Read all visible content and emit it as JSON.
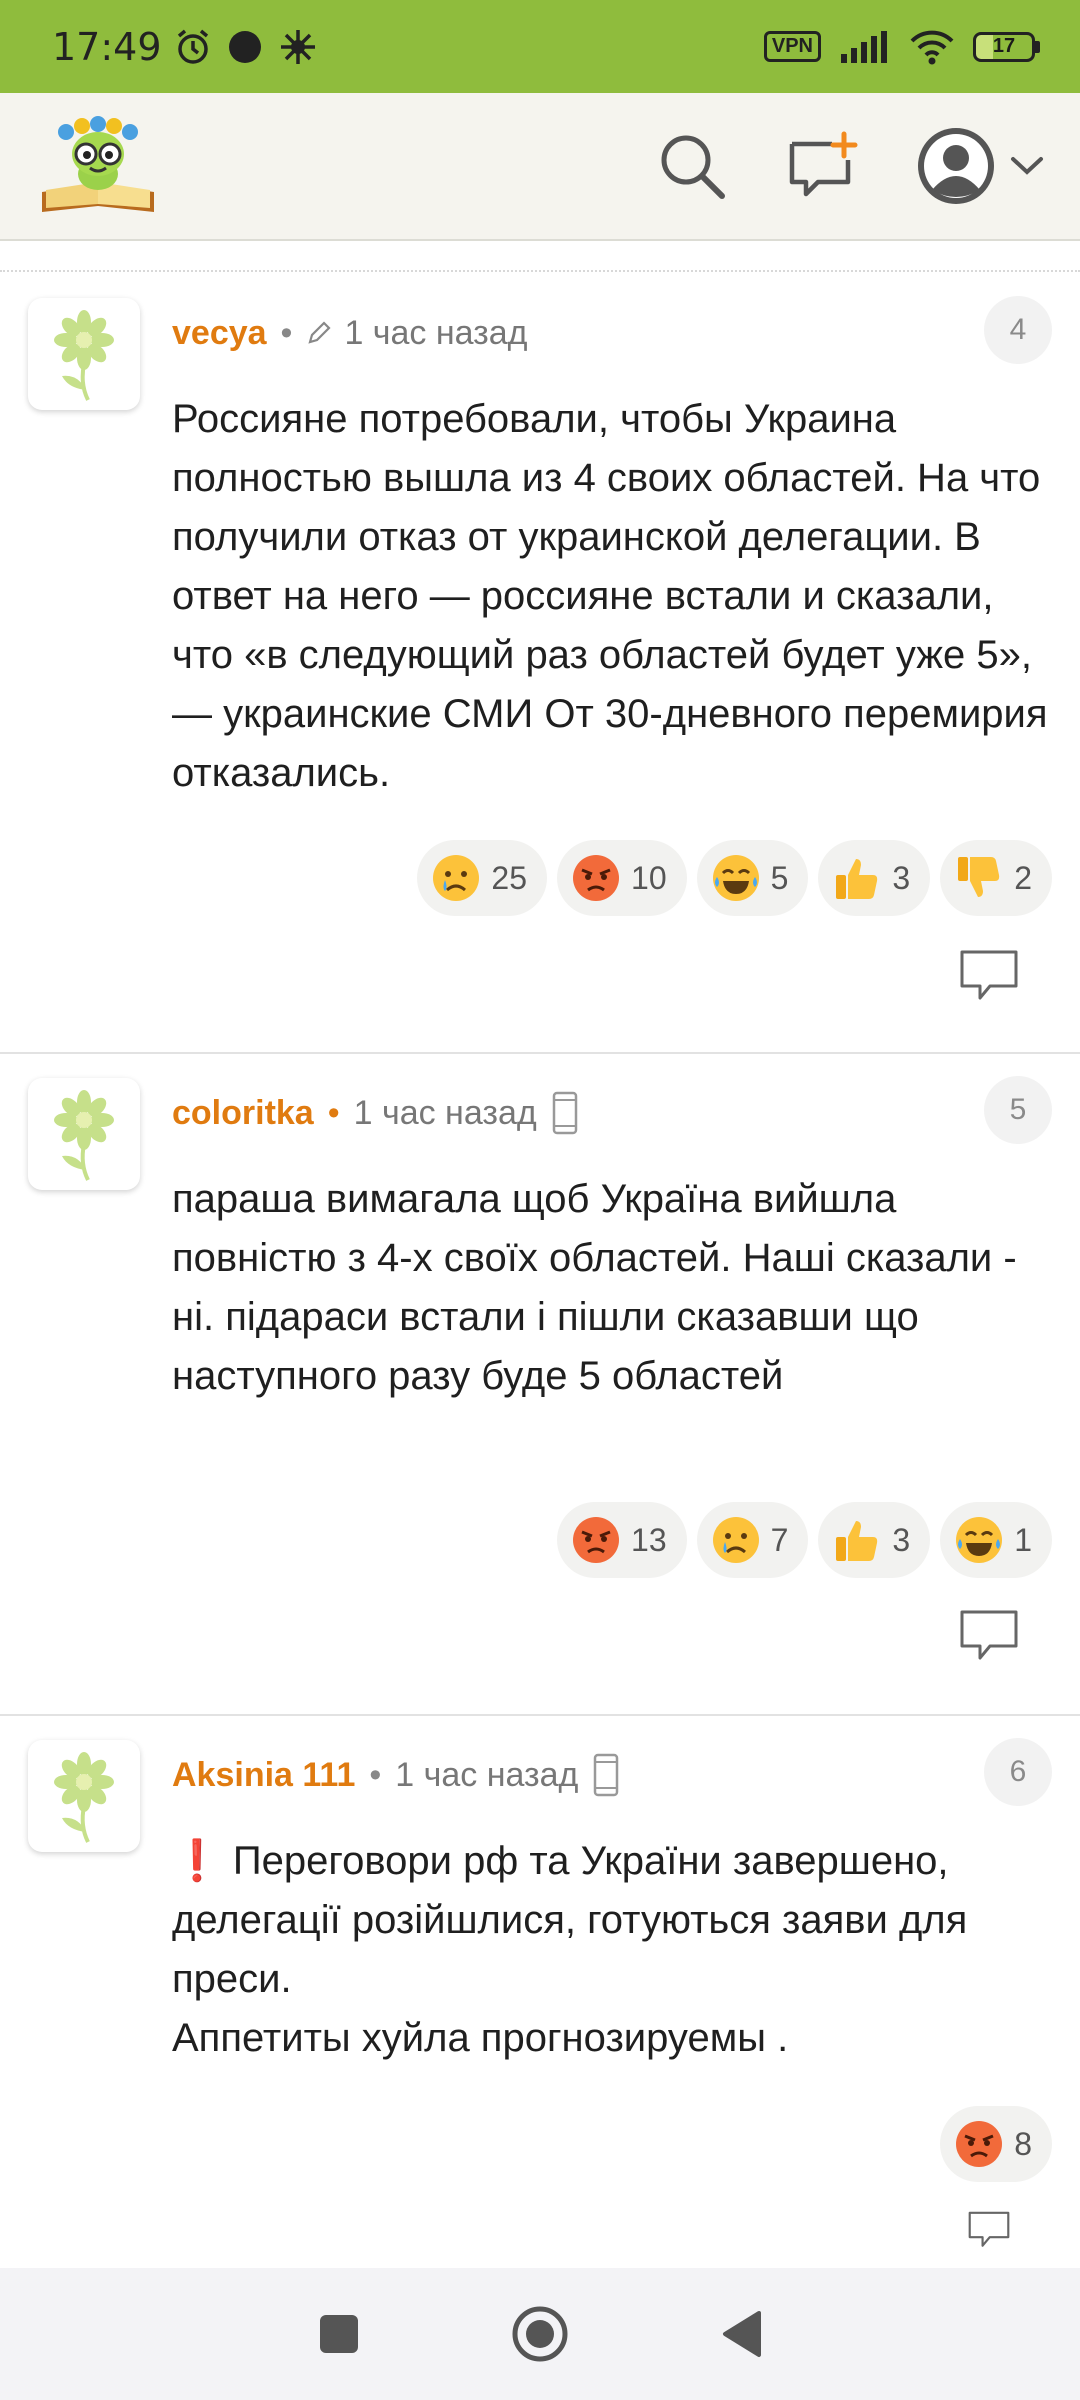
{
  "status_bar": {
    "time": "17:49",
    "vpn_label": "VPN",
    "battery_level": "17"
  },
  "header": {
    "logo_icon": "bookworm-logo-icon",
    "search_icon": "search-icon",
    "new_post_icon": "new-post-icon",
    "profile_icon": "user-avatar-icon",
    "dropdown_icon": "chevron-down-icon"
  },
  "comments": [
    {
      "author": "vecya",
      "time": "1 час назад",
      "edited": true,
      "number": "4",
      "text": "Россияне потребовали, чтобы Украина полностью вышла из 4 своих областей. На что получили отказ от украинской делегации. В ответ на него — россияне встали и сказали, что «в следующий раз областей будет уже 5», — украинские СМИ От 30-дневного перемирия отказались.",
      "reactions": [
        {
          "icon": "crying-face",
          "count": "25"
        },
        {
          "icon": "angry-face",
          "count": "10"
        },
        {
          "icon": "laughing-face",
          "count": "5"
        },
        {
          "icon": "thumbs-up",
          "count": "3"
        },
        {
          "icon": "thumbs-down",
          "count": "2"
        }
      ]
    },
    {
      "author": "coloritka",
      "time": "1 час назад",
      "mobile": true,
      "number": "5",
      "text": "параша вимагала щоб Україна вийшла повністю з 4-х своїх областей. Наші сказали - ні. підараси встали і пішли сказавши що наступного разу буде 5 областей",
      "reactions": [
        {
          "icon": "angry-face",
          "count": "13"
        },
        {
          "icon": "crying-face",
          "count": "7"
        },
        {
          "icon": "thumbs-up",
          "count": "3"
        },
        {
          "icon": "laughing-face",
          "count": "1"
        }
      ]
    },
    {
      "author": "Aksinia 111",
      "time": "1 час назад",
      "mobile": true,
      "number": "6",
      "text": "❗ Переговори рф та України завершено, делегації розійшлися, готуються заяви для преси.\nАппетиты хуйла прогнозируемы .",
      "reactions": [
        {
          "icon": "angry-face",
          "count": "8"
        }
      ]
    }
  ],
  "nav": {
    "recents_icon": "square-recents-icon",
    "home_icon": "circle-home-icon",
    "back_icon": "triangle-back-icon"
  }
}
